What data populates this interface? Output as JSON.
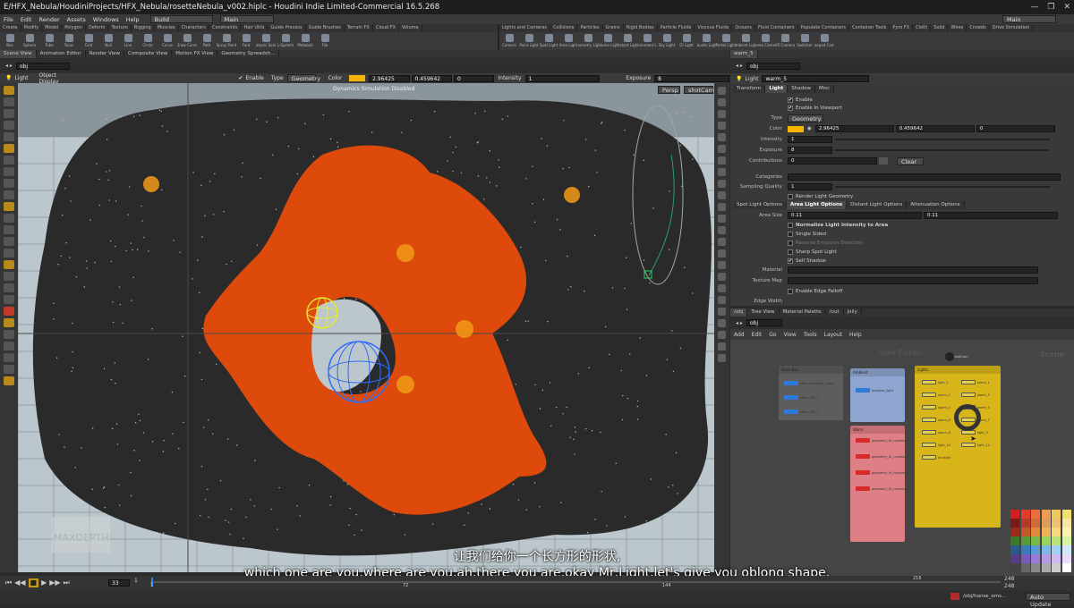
{
  "window": {
    "title": "E/HFX_Nebula/HoudiniProjects/HFX_Nebula/rosetteNebula_v002.hiplc - Houdini Indie Limited-Commercial 16.5.268",
    "controls": [
      "—",
      "❐",
      "✕"
    ]
  },
  "menu": {
    "items": [
      "File",
      "Edit",
      "Render",
      "Assets",
      "Windows",
      "Help"
    ],
    "desktop": "Build",
    "context": "Main",
    "right_context": "Main"
  },
  "shelf": {
    "left_tabs": [
      "Create",
      "Modify",
      "Model",
      "Polygon",
      "Deform",
      "Texture",
      "Rigging",
      "Muscles",
      "Characters",
      "Constraints",
      "Hair Utils",
      "Guide Process",
      "Guide Brushes",
      "Terrain FX",
      "Cloud FX",
      "Volume"
    ],
    "left_tools": [
      "Box",
      "Sphere",
      "Tube",
      "Torus",
      "Grid",
      "Null",
      "Line",
      "Circle",
      "Curve",
      "Draw Curve",
      "Path",
      "Spray Paint",
      "Font",
      "Platonic Solids",
      "L-System",
      "Metaball",
      "File"
    ],
    "right_tabs": [
      "Lights and Cameras",
      "Collisions",
      "Particles",
      "Grains",
      "Rigid Bodies",
      "Particle Fluids",
      "Viscous Fluids",
      "Oceans",
      "Fluid Containers",
      "Populate Containers",
      "Container Tools",
      "Pyro FX",
      "Cloth",
      "Solid",
      "Wires",
      "Crowds",
      "Drive Simulation"
    ],
    "right_tools": [
      "Camera",
      "Point Light",
      "Spot Light",
      "Area Light",
      "Geometry Light",
      "Volume Light",
      "Distant Light",
      "Environment Light",
      "Sky Light",
      "GI Light",
      "Caustic Light",
      "Portal Light",
      "Ambient Light",
      "Stereo Camera",
      "VR Camera",
      "Switcher",
      "Gamepad Camera"
    ]
  },
  "left_pane": {
    "tabs": [
      "Scene View",
      "Animation Editor",
      "Render View",
      "Composite View",
      "Motion FX View",
      "Geometry Spreadsh..."
    ],
    "path": "obj"
  },
  "viewport_toolbar": {
    "node_label": "Light",
    "display": "Object Display",
    "enable_label": "Enable",
    "type_label": "Type",
    "type_value": "Geometry",
    "color_label": "Color",
    "color_swatch": "#f5b400",
    "color_r": "2.96425",
    "color_g": "0.459642",
    "color_b": "0",
    "intensity_label": "Intensity",
    "intensity_value": "1",
    "exposure_label": "Exposure",
    "exposure_value": "8"
  },
  "viewport": {
    "message": "Dynamics Simulation Disabled",
    "view_mode": "Persp",
    "camera": "shotCam",
    "watermark_1": "MAXDEPTH",
    "watermark_2": "MAXDEPTH",
    "nebula_color": "#dd4a0c"
  },
  "right_pane": {
    "tab": "warm_5",
    "path": "obj",
    "node_type": "Light",
    "node_name": "warm_5",
    "param_tabs": [
      "Transform",
      "Light",
      "Shadow",
      "Misc"
    ],
    "params": {
      "enable": "Enable",
      "enable_viewport": "Enable In Viewport",
      "type_label": "Type",
      "type_value": "Geometry",
      "color_label": "Color",
      "color_r": "2.96425",
      "color_g": "0.459642",
      "color_b": "0",
      "intensity_label": "Intensity",
      "intensity_value": "1",
      "exposure_label": "Exposure",
      "exposure_value": "8",
      "contributions_label": "Contributions",
      "contributions_value": "0",
      "clear_label": "Clear",
      "categories_label": "Categories",
      "sampling_label": "Sampling Quality",
      "sampling_value": "1",
      "render_geo": "Render Light Geometry"
    },
    "light_tabs": [
      "Spot Light Options",
      "Area Light Options",
      "Distant Light Options",
      "Attenuation Options"
    ],
    "area": {
      "size_label": "Area Size",
      "size_x": "0.11",
      "size_y": "0.11",
      "normalize": "Normalize Light Intensity to Area",
      "single_sided": "Single Sided",
      "reverse": "Reverse Emission Direction",
      "sharp": "Sharp Spot Light",
      "self_shadow": "Self Shadow",
      "material_label": "Material",
      "texture_label": "Texture Map",
      "edge_falloff": "Enable Edge Falloff",
      "edge_width": "Edge Width"
    }
  },
  "network": {
    "tabs": [
      "/obj",
      "Tree View",
      "Material Palette",
      "/out",
      "Jolly"
    ],
    "path": "obj",
    "menus": [
      "Add",
      "Edit",
      "Go",
      "View",
      "Tools",
      "Layout",
      "Help"
    ],
    "edition": "Indie Edition",
    "scene_label": "Scene",
    "camera_node": "shotCam",
    "boxes": [
      {
        "label": "Stars Box",
        "color": "#5d5d5d"
      },
      {
        "label": "Ambient",
        "color": "#8ea6cf"
      },
      {
        "label": "Lights",
        "color": "#d8b61a"
      },
      {
        "label": "Warm",
        "color": "#de7f86"
      }
    ],
    "star_nodes": [
      "stars_abrupted_cloud",
      "stars_001_1",
      "stars_002_1"
    ],
    "ambient_nodes": [
      "ambient_light"
    ],
    "warm_nodes": [
      "geometry_llt_crystals_1",
      "geometry_llt_crystals_2",
      "geometry_llt_crystals_3",
      "geometry_llt_crystals_4"
    ],
    "light_nodes": [
      "light_1",
      "warm_1",
      "warm_2",
      "warm_3",
      "warm_4",
      "warm_5",
      "warm_6",
      "warm_7",
      "warm_8",
      "light_9",
      "light_10",
      "light_11",
      "envlight"
    ]
  },
  "palette_colors": [
    "#d22020",
    "#e23c2c",
    "#ea6d3c",
    "#ef9a4c",
    "#f0c75a",
    "#eee06a",
    "#7a1a1a",
    "#b43a2a",
    "#d06a3a",
    "#e09a5a",
    "#f0c070",
    "#f8e7a0",
    "#9a2a1a",
    "#c05a2a",
    "#e08a3a",
    "#f0b05a",
    "#f8d87a",
    "#fff2b0",
    "#3a7a2a",
    "#5a9a3a",
    "#7ab84a",
    "#9ad45a",
    "#b8e478",
    "#d8f4a0",
    "#2a5a8a",
    "#3a7ab8",
    "#5a9ad4",
    "#7ab8e8",
    "#a0d0f4",
    "#cfe8ff",
    "#5a3a8a",
    "#7a5ab8",
    "#9a7ad4",
    "#b898e8",
    "#d0b8f4",
    "#eedcff",
    "#444444",
    "#666666",
    "#888888",
    "#aaaaaa",
    "#cccccc",
    "#ffffff"
  ],
  "subtitles": {
    "cn": "让我们给你一个长方形的形状,",
    "en": "which one are you,where are you,ah,there you are,okay Mr,Light,let's give you oblong shape,"
  },
  "timeline": {
    "current_frame": "33",
    "start_frame": "1",
    "end_frame": "248",
    "end_frame_2": "248",
    "ticks": [
      "1",
      "72",
      "144",
      "216"
    ]
  },
  "status": {
    "path": "/obj/hanse_ems...",
    "update_mode": "Auto Update"
  }
}
